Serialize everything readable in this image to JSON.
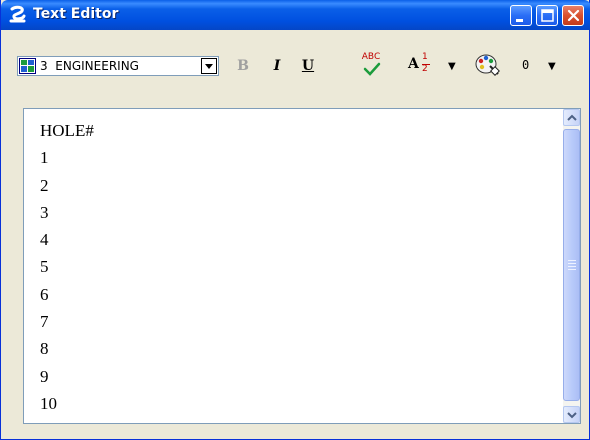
{
  "window": {
    "title": "Text Editor",
    "icon": "microstation-logo-icon"
  },
  "toolbar": {
    "level_number": "3",
    "level_name": "ENGINEERING",
    "bold_label": "B",
    "italic_label": "I",
    "underline_label": "U",
    "spell_label": "ABC",
    "fraction_letter": "A",
    "fraction_numerator": "1",
    "fraction_denominator": "2",
    "color_value": "0"
  },
  "editor": {
    "lines": [
      "HOLE#",
      "1",
      "2",
      "3",
      "4",
      "5",
      "6",
      "7",
      "8",
      "9",
      "10"
    ]
  },
  "colors": {
    "title_bar": "#0a5fe8",
    "window_face": "#ece9d8",
    "close_button": "#d9502e",
    "disabled_text": "#a0a0a0"
  }
}
